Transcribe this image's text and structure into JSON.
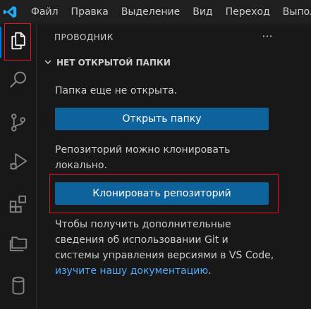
{
  "menu": {
    "items": [
      "Файл",
      "Правка",
      "Выделение",
      "Вид",
      "Переход",
      "Выпол"
    ]
  },
  "activity_bar": {
    "items": [
      {
        "name": "explorer",
        "icon": "files-icon",
        "active": true
      },
      {
        "name": "search",
        "icon": "search-icon"
      },
      {
        "name": "source-control",
        "icon": "source-control-icon"
      },
      {
        "name": "run-debug",
        "icon": "run-debug-icon"
      },
      {
        "name": "extensions",
        "icon": "extensions-icon"
      },
      {
        "name": "folders",
        "icon": "folders-icon"
      },
      {
        "name": "database",
        "icon": "database-icon"
      }
    ]
  },
  "sidebar": {
    "title": "ПРОВОДНИК",
    "more_label": "···",
    "section_title": "НЕТ ОТКРЫТОЙ ПАПКИ",
    "no_folder_text": "Папка еще не открыта.",
    "open_folder_button": "Открыть папку",
    "clone_text_line1": "Репозиторий можно клонировать",
    "clone_text_line2": "локально.",
    "clone_button": "Клонировать репозиторий",
    "docs_line1": "Чтобы получить дополнительные",
    "docs_line2": "сведения об использовании Git и",
    "docs_line3": "системы управления версиями в VS Code,",
    "docs_link": "изучите нашу документацию",
    "docs_end": "."
  },
  "colors": {
    "accent": "#0078d4",
    "button": "#0e639c",
    "link": "#4daafc",
    "highlight": "#e81123"
  }
}
